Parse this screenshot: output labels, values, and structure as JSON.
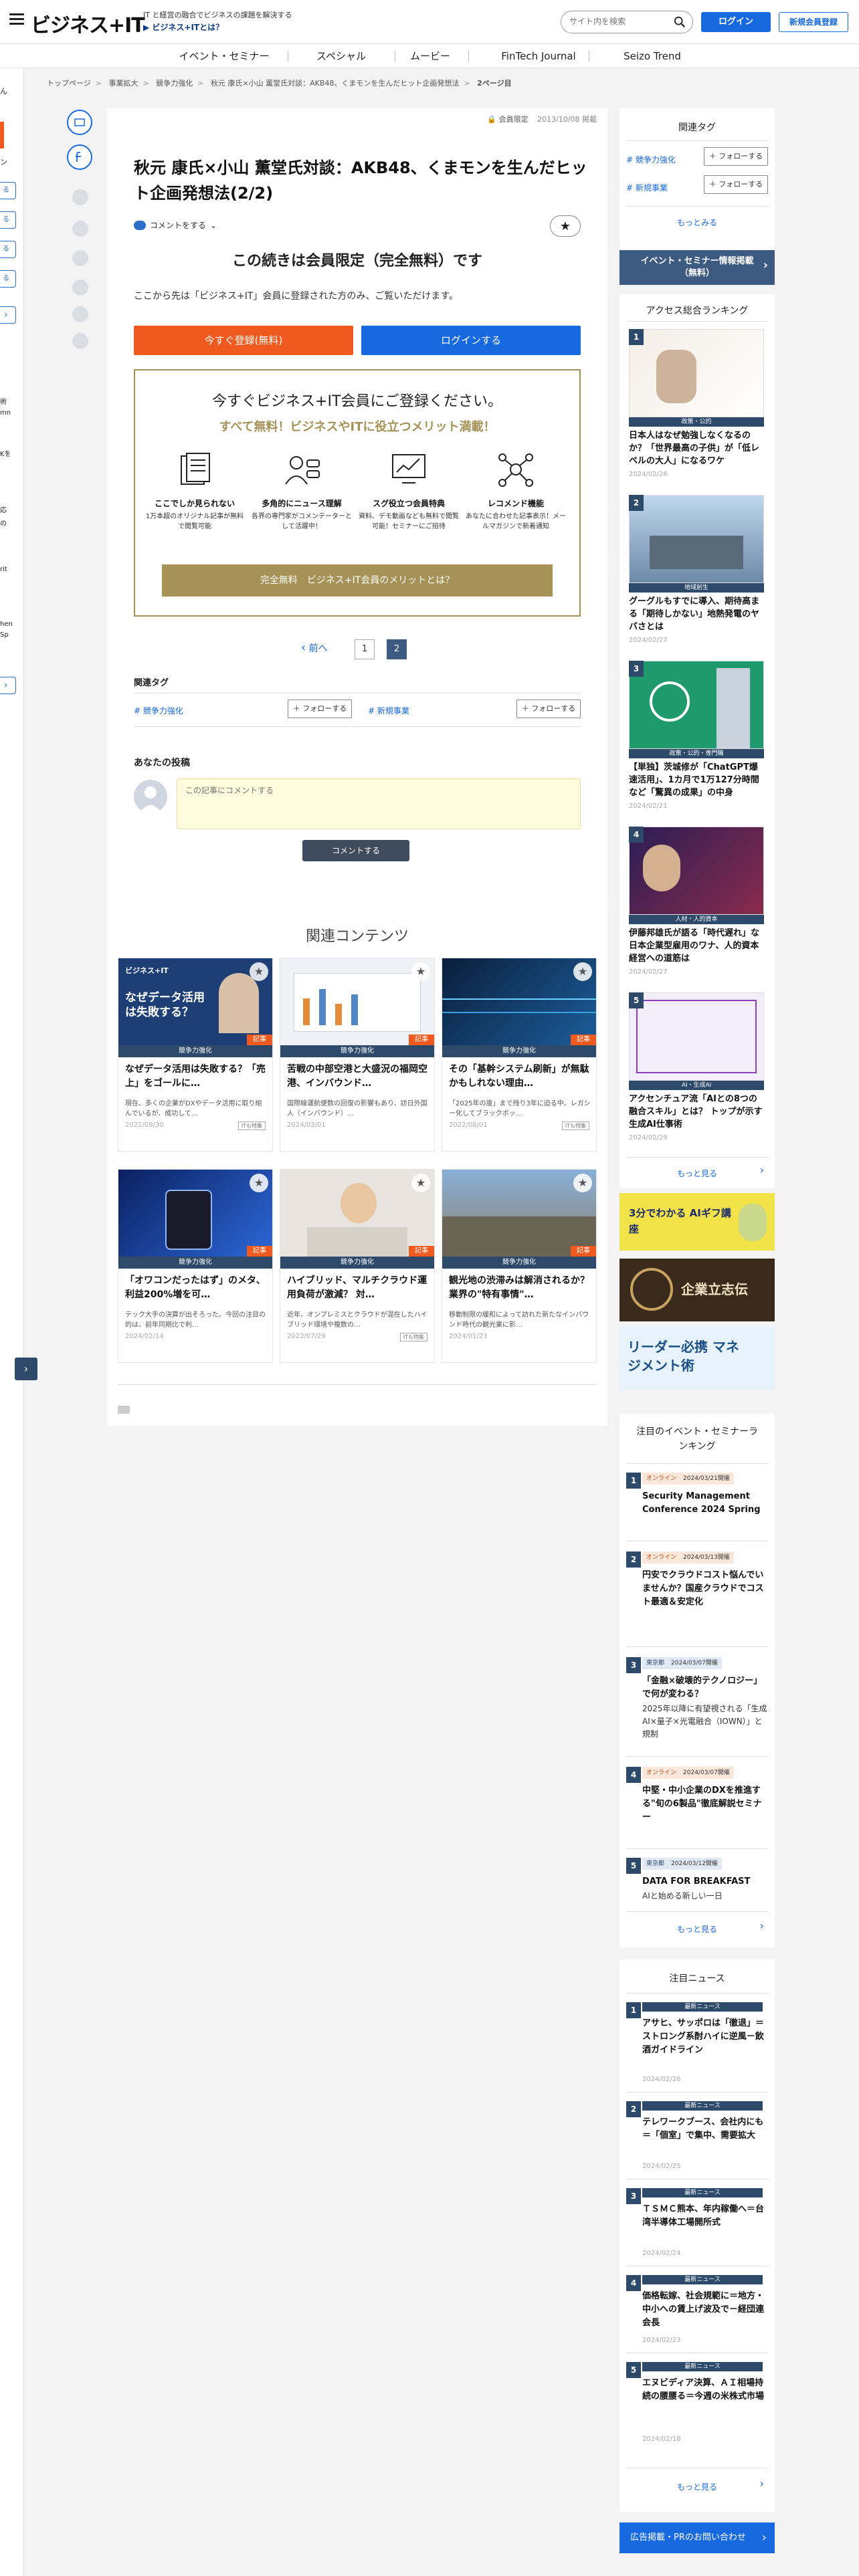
{
  "header": {
    "logo": "ビジネス+IT",
    "tagline": "IT と経営の融合でビジネスの課題を解決する",
    "what_link": "ビジネス+ITとは？",
    "search_placeholder": "サイト内を検索",
    "login": "ログイン",
    "register": "新規会員登録"
  },
  "gnav": [
    "イベント・セミナー",
    "スペシャル",
    "ムービー",
    "FinTech Journal",
    "Seizo Trend"
  ],
  "breadcrumb": [
    "トップページ",
    "事業拡大",
    "競争力強化",
    "秋元 康氏×小山 薫堂氏対談：AKB48、くまモンを生んだヒット企画発想法",
    "2ページ目"
  ],
  "left_strip": [
    "ん",
    "ン",
    "る",
    "る",
    "る",
    "る",
    "術",
    "mn",
    "Kを",
    "応",
    "の",
    "rit",
    "hen",
    "Sp"
  ],
  "article": {
    "badge": "会員限定",
    "date": "2013/10/08 掲載",
    "title": "秋元 康氏×小山 薫堂氏対談：AKB48、くまモンを生んだヒット企画発想法(2/2)",
    "comment_link": "コメントをする",
    "members_title": "この続きは会員限定（完全無料）です",
    "members_sub": "ここから先は「ビジネス+IT」会員に登録された方のみ、ご覧いただけます。",
    "register_now": "今すぐ登録(無料)",
    "login_now": "ログインする"
  },
  "promo": {
    "heading": "今すぐビジネス+IT会員にご登録ください。",
    "subheading": "すべて無料！ビジネスやITに役立つメリット満載！",
    "benefits": [
      {
        "title": "ここでしか見られない",
        "desc": "1万本超のオリジナル記事が無料で閲覧可能"
      },
      {
        "title": "多角的にニュース理解",
        "desc": "各界の専門家がコメンテーターとして活躍中！"
      },
      {
        "title": "スグ役立つ会員特典",
        "desc": "資料、デモ動画なども無料で閲覧可能！セミナーにご招待"
      },
      {
        "title": "レコメンド機能",
        "desc": "あなたに合わせた記事表示！メールマガジンで新着通知"
      }
    ],
    "button": "完全無料　ビジネス+IT会員のメリットとは？"
  },
  "pager": {
    "prev": "前へ",
    "pages": [
      "1",
      "2"
    ]
  },
  "related_tags": {
    "heading": "関連タグ",
    "tags": [
      "# 競争力強化",
      "# 新規事業"
    ],
    "follow": "＋ フォローする"
  },
  "post": {
    "heading": "あなたの投稿",
    "placeholder": "この記事にコメントする",
    "submit": "コメントする"
  },
  "related": {
    "heading": "関連コンテンツ",
    "kind": "記事",
    "cards": [
      {
        "cat": "競争力強化",
        "title": "なぜデータ活用は失敗する？「売上」をゴールに…",
        "desc": "現在、多くの企業がDXやデータ活用に取り組んでいるが、成功して…",
        "date": "2022/09/30",
        "badge": "ITも特集",
        "thumb_text": "なぜデータ活用は失敗する？"
      },
      {
        "cat": "競争力強化",
        "title": "苦戦の中部空港と大盛況の福岡空港、インバウンド…",
        "desc": "国際線運航便数の回復の影響もあり、訪日外国人（インバウンド）…",
        "date": "2024/03/01",
        "badge": "",
        "thumb_text": ""
      },
      {
        "cat": "競争力強化",
        "title": "その「基幹システム刷新」が無駄かもしれない理由…",
        "desc": "「2025年の崖」まで残り3年に迫る中、レガシー化してブラックボッ…",
        "date": "2022/08/01",
        "badge": "ITも特集",
        "thumb_text": ""
      },
      {
        "cat": "競争力強化",
        "title": "「オワコンだったはず」のメタ、利益200%増を可…",
        "desc": "テック大手の決算が出そろった。今回の注目の的は、前年同期比で利…",
        "date": "2024/02/14",
        "badge": "",
        "thumb_text": ""
      },
      {
        "cat": "競争力強化",
        "title": "ハイブリッド、マルチクラウド運用負荷が激減？ 対…",
        "desc": "近年、オンプレミスとクラウドが混在したハイブリッド環境や複数の…",
        "date": "2022/07/29",
        "badge": "ITも特集",
        "thumb_text": ""
      },
      {
        "cat": "競争力強化",
        "title": "観光地の渋滞みは解消されるか？業界の\"特有事情\"…",
        "desc": "移動制限の緩和によって訪れた新たなインバウンド時代の観光業に影…",
        "date": "2024/01/23",
        "badge": "",
        "thumb_text": ""
      }
    ]
  },
  "sidebar": {
    "tags_heading": "関連タグ",
    "tags": [
      "# 競争力強化",
      "# 新規事業"
    ],
    "follow": "＋ フォローする",
    "see_all": "もっとみる",
    "event_banner": "イベント・セミナー情報掲載（無料）",
    "ranking_heading": "アクセス総合ランキング",
    "ranking": [
      {
        "num": "1",
        "cat": "政策・公的",
        "title": "日本人はなぜ勉強しなくなるのか？「世界最高の子供」が「低レベルの大人」になるワケ",
        "date": "2024/02/26"
      },
      {
        "num": "2",
        "cat": "地域創生",
        "title": "グーグルもすでに導入、期待高まる「期待しかない」地熱発電のヤバさとは",
        "date": "2024/02/27"
      },
      {
        "num": "3",
        "cat": "政策・公的・専門職",
        "title": "【単独】茨城修が「ChatGPT爆速活用」、1カ月で1万127分時間など「驚異の成果」の中身",
        "date": "2024/02/21"
      },
      {
        "num": "4",
        "cat": "人材・人的資本",
        "title": "伊藤邦雄氏が語る「時代遅れ」な日本企業型雇用のワナ、人的資本経営への道筋は",
        "date": "2024/02/27"
      },
      {
        "num": "5",
        "cat": "AI・生成AI",
        "title": "アクセンチュア流「AIとの8つの融合スキル」とは？ トップが示す生成AI仕事術",
        "date": "2024/02/29"
      }
    ],
    "see_more": "もっと見る",
    "banners": [
      "3分でわかる AIギフ講座",
      "企業立志伝",
      "リーダー必携 マネジメント術"
    ],
    "events_heading": "注目のイベント・セミナーランキング",
    "events": [
      {
        "num": "1",
        "tag": "オンライン",
        "date": "2024/03/21開催",
        "title": "Security Management Conference 2024 Spring",
        "sub": ""
      },
      {
        "num": "2",
        "tag": "オンライン",
        "date": "2024/03/13開催",
        "title": "円安でクラウドコスト悩んでいませんか？国産クラウドでコスト最適＆安定化",
        "sub": ""
      },
      {
        "num": "3",
        "tag": "東京都",
        "date": "2024/03/07開催",
        "title": "「金融×破壊的テクノロジー」で何が変わる？",
        "sub": "2025年以降に有望視される「生成AI×量子×光電融合（IOWN）」と規制"
      },
      {
        "num": "4",
        "tag": "オンライン",
        "date": "2024/03/07開催",
        "title": "中堅・中小企業のDXを推進する\"旬の6製品\"徹底解説セミナー",
        "sub": ""
      },
      {
        "num": "5",
        "tag": "東京都",
        "date": "2024/03/12開催",
        "title": "DATA FOR BREAKFAST",
        "sub": "AIと始める新しい一日"
      }
    ],
    "news_heading": "注目ニュース",
    "news": [
      {
        "num": "1",
        "cat": "最新ニュース",
        "title": "アサヒ、サッポロは「徹退」＝ストロング系酎ハイに逆風－飲酒ガイドライン",
        "date": "2024/02/26"
      },
      {
        "num": "2",
        "cat": "最新ニュース",
        "title": "テレワークブース、会社内にも＝「個室」で集中、需要拡大",
        "date": "2024/02/25"
      },
      {
        "num": "3",
        "cat": "最新ニュース",
        "title": "ＴＳＭＣ熊本、年内稼働へ＝台湾半導体工場開所式",
        "date": "2024/02/24"
      },
      {
        "num": "4",
        "cat": "最新ニュース",
        "title": "価格転嫁、社会規範に＝地方・中小への賃上げ波及で－経団連会長",
        "date": "2024/02/23"
      },
      {
        "num": "5",
        "cat": "最新ニュース",
        "title": "エヌビディア決算、ＡＩ相場持続の腰腰る＝今週の米株式市場",
        "date": "2024/02/18"
      }
    ],
    "ad_contact": "広告掲載・PRのお問い合わせ"
  },
  "colors": {
    "accent": "#1769e0",
    "orange": "#f05a1e",
    "gold": "#a69257",
    "navy": "#2d4a6b"
  }
}
